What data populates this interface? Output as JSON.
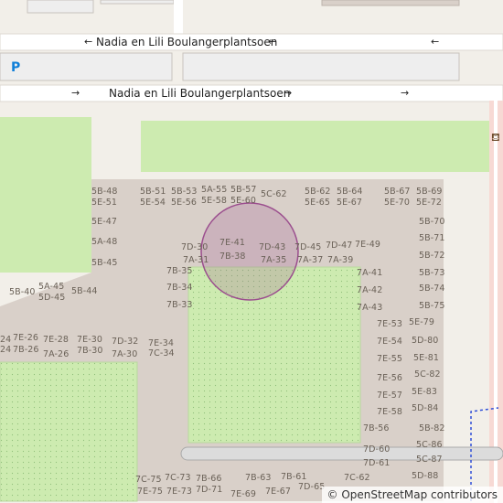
{
  "colors": {
    "land": "#f2efe9",
    "road": "#ffffff",
    "grass": "#cdebb0",
    "building_area": "#d9d0c9",
    "parking": "#eeeeee",
    "marker": "#9b4e8e",
    "cycleway": "#2f4fd8"
  },
  "streets": {
    "upper_name": "Nadia en Lili Boulangerplantsoen",
    "lower_name": "Nadia en Lili Boulangerplantsoen",
    "upper_arrow_left": "←",
    "upper_arrow_right": "←",
    "upper_arrow_extra": "←",
    "lower_arrow_left": "→",
    "lower_arrow_right": "→",
    "lower_arrow_extra": "→"
  },
  "parking_symbol": "P",
  "icons": [
    "parking-icon",
    "bench-icon"
  ],
  "attribution": "© OpenStreetMap contributors",
  "address_labels": [
    {
      "text": "5B-48",
      "id": "a1"
    },
    {
      "text": "5E-51",
      "id": "a2"
    },
    {
      "text": "5B-51",
      "id": "a3"
    },
    {
      "text": "5E-54",
      "id": "a4"
    },
    {
      "text": "5B-53",
      "id": "a5"
    },
    {
      "text": "5E-56",
      "id": "a6"
    },
    {
      "text": "5A-55",
      "id": "a7"
    },
    {
      "text": "5E-58",
      "id": "a8"
    },
    {
      "text": "5B-57",
      "id": "a9"
    },
    {
      "text": "5E-60",
      "id": "a10"
    },
    {
      "text": "5C-62",
      "id": "a11"
    },
    {
      "text": "5B-62",
      "id": "a12"
    },
    {
      "text": "5E-65",
      "id": "a13"
    },
    {
      "text": "5B-64",
      "id": "a14"
    },
    {
      "text": "5E-67",
      "id": "a15"
    },
    {
      "text": "5B-67",
      "id": "a16"
    },
    {
      "text": "5E-70",
      "id": "a17"
    },
    {
      "text": "5B-69",
      "id": "a18"
    },
    {
      "text": "5E-72",
      "id": "a19"
    },
    {
      "text": "5E-47",
      "id": "a20"
    },
    {
      "text": "5B-70",
      "id": "a21"
    },
    {
      "text": "5A-48",
      "id": "a22"
    },
    {
      "text": "5B-71",
      "id": "a23"
    },
    {
      "text": "7D-30",
      "id": "a24"
    },
    {
      "text": "7E-41",
      "id": "a25"
    },
    {
      "text": "7D-43",
      "id": "a26"
    },
    {
      "text": "7D-45",
      "id": "a27"
    },
    {
      "text": "7D-47",
      "id": "a28"
    },
    {
      "text": "7E-49",
      "id": "a29"
    },
    {
      "text": "7A-31",
      "id": "a30"
    },
    {
      "text": "7B-38",
      "id": "a31"
    },
    {
      "text": "7A-35",
      "id": "a32"
    },
    {
      "text": "7A-37",
      "id": "a33"
    },
    {
      "text": "7A-39",
      "id": "a34"
    },
    {
      "text": "5B-72",
      "id": "a35"
    },
    {
      "text": "5B-45",
      "id": "a36"
    },
    {
      "text": "7B-35",
      "id": "a37"
    },
    {
      "text": "7A-41",
      "id": "a38"
    },
    {
      "text": "5B-73",
      "id": "a39"
    },
    {
      "text": "5A-45",
      "id": "a40"
    },
    {
      "text": "5D-45",
      "id": "a41"
    },
    {
      "text": "5B-40",
      "id": "a42"
    },
    {
      "text": "5B-44",
      "id": "a43"
    },
    {
      "text": "7B-34",
      "id": "a44"
    },
    {
      "text": "7A-42",
      "id": "a45"
    },
    {
      "text": "5B-74",
      "id": "a46"
    },
    {
      "text": "7B-33",
      "id": "a47"
    },
    {
      "text": "7A-43",
      "id": "a48"
    },
    {
      "text": "5B-75",
      "id": "a49"
    },
    {
      "text": "7E-53",
      "id": "a50"
    },
    {
      "text": "5E-79",
      "id": "a51"
    },
    {
      "text": "7E-26",
      "id": "a52"
    },
    {
      "text": "7E-28",
      "id": "a53"
    },
    {
      "text": "7E-30",
      "id": "a54"
    },
    {
      "text": "7D-32",
      "id": "a55"
    },
    {
      "text": "7E-34",
      "id": "a56"
    },
    {
      "text": "7E-54",
      "id": "a57"
    },
    {
      "text": "5D-80",
      "id": "a58"
    },
    {
      "text": "7B-26",
      "id": "a59"
    },
    {
      "text": "7A-26",
      "id": "a60"
    },
    {
      "text": "7B-30",
      "id": "a61"
    },
    {
      "text": "7A-30",
      "id": "a62"
    },
    {
      "text": "7C-34",
      "id": "a63"
    },
    {
      "text": "7E-55",
      "id": "a64"
    },
    {
      "text": "5E-81",
      "id": "a65"
    },
    {
      "text": "7E-56",
      "id": "a66"
    },
    {
      "text": "5C-82",
      "id": "a67"
    },
    {
      "text": "7E-57",
      "id": "a68"
    },
    {
      "text": "5E-83",
      "id": "a69"
    },
    {
      "text": "7E-58",
      "id": "a70"
    },
    {
      "text": "5D-84",
      "id": "a71"
    },
    {
      "text": "7B-56",
      "id": "a72"
    },
    {
      "text": "5B-82",
      "id": "a73"
    },
    {
      "text": "5C-86",
      "id": "a74"
    },
    {
      "text": "7D-60",
      "id": "a75"
    },
    {
      "text": "5C-87",
      "id": "a76"
    },
    {
      "text": "7D-61",
      "id": "a77"
    },
    {
      "text": "7C-75",
      "id": "a78"
    },
    {
      "text": "7C-73",
      "id": "a79"
    },
    {
      "text": "7B-66",
      "id": "a80"
    },
    {
      "text": "7B-63",
      "id": "a81"
    },
    {
      "text": "7B-61",
      "id": "a82"
    },
    {
      "text": "7C-62",
      "id": "a83"
    },
    {
      "text": "5D-88",
      "id": "a84"
    },
    {
      "text": "7E-75",
      "id": "a85"
    },
    {
      "text": "7E-73",
      "id": "a86"
    },
    {
      "text": "7D-71",
      "id": "a87"
    },
    {
      "text": "7E-69",
      "id": "a88"
    },
    {
      "text": "7E-67",
      "id": "a89"
    },
    {
      "text": "7D-65",
      "id": "a90"
    },
    {
      "text": "24",
      "id": "a91"
    },
    {
      "text": "24",
      "id": "a92"
    }
  ]
}
